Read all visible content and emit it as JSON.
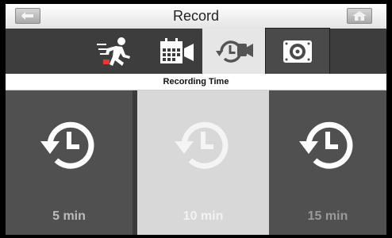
{
  "header": {
    "title": "Record",
    "left_icon": "back-icon",
    "right_icon": "home-icon"
  },
  "tabs": [
    {
      "name": "motion-detect",
      "icon": "running-person-icon",
      "selected": false
    },
    {
      "name": "schedule",
      "icon": "calendar-camera-icon",
      "selected": false
    },
    {
      "name": "recording-time",
      "icon": "clock-camera-icon",
      "selected": true
    },
    {
      "name": "storage",
      "icon": "disk-icon",
      "selected": false
    }
  ],
  "section": {
    "title": "Recording Time"
  },
  "options": [
    {
      "label": "5 min",
      "icon": "history-clock-icon",
      "selected": false
    },
    {
      "label": "10 min",
      "icon": "history-clock-icon",
      "selected": true
    },
    {
      "label": "15 min",
      "icon": "history-clock-icon",
      "selected": false
    }
  ],
  "colors": {
    "accent_selected_bg": "#d8d8d8",
    "panel_bg": "#505050",
    "tab_bg": "#3d3d3d"
  }
}
